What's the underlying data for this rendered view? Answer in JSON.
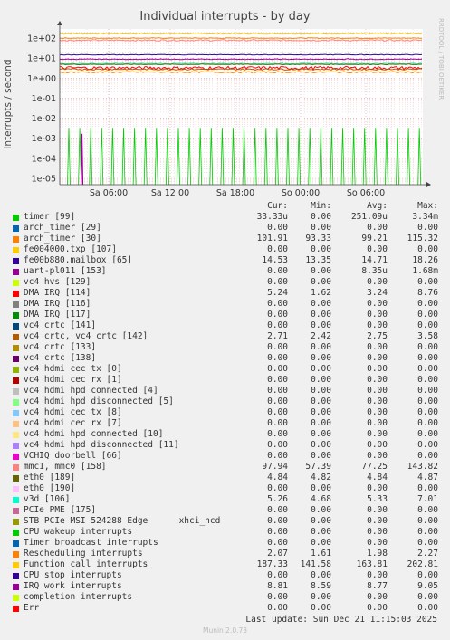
{
  "title": "Individual interrupts - by day",
  "side_text": "RRDTOOL / TOBI OETIKER",
  "footer": {
    "last_update": "Last update: Sun Dec 21 11:15:03 2025",
    "munin": "Munin 2.0.73"
  },
  "legend_headers": {
    "cur": "Cur:",
    "min": "Min:",
    "avg": "Avg:",
    "max": "Max:"
  },
  "legend": [
    {
      "label": "timer [99]",
      "color": "#00cc00",
      "cur": "33.33u",
      "min": "0.00",
      "avg": "251.09u",
      "max": "3.34m"
    },
    {
      "label": "arch_timer [29]",
      "color": "#0066b3",
      "cur": "0.00",
      "min": "0.00",
      "avg": "0.00",
      "max": "0.00"
    },
    {
      "label": "arch_timer [30]",
      "color": "#ff8000",
      "cur": "101.91",
      "min": "93.33",
      "avg": "99.21",
      "max": "115.32"
    },
    {
      "label": "fe004000.txp [107]",
      "color": "#ffcc00",
      "cur": "0.00",
      "min": "0.00",
      "avg": "0.00",
      "max": "0.00"
    },
    {
      "label": "fe00b880.mailbox [65]",
      "color": "#330099",
      "cur": "14.53",
      "min": "13.35",
      "avg": "14.71",
      "max": "18.26"
    },
    {
      "label": "uart-pl011 [153]",
      "color": "#990099",
      "cur": "0.00",
      "min": "0.00",
      "avg": "8.35u",
      "max": "1.68m"
    },
    {
      "label": "vc4 hvs [129]",
      "color": "#ccff00",
      "cur": "0.00",
      "min": "0.00",
      "avg": "0.00",
      "max": "0.00"
    },
    {
      "label": "DMA IRQ [114]",
      "color": "#ff0000",
      "cur": "5.24",
      "min": "1.62",
      "avg": "3.24",
      "max": "8.76"
    },
    {
      "label": "DMA IRQ [116]",
      "color": "#808080",
      "cur": "0.00",
      "min": "0.00",
      "avg": "0.00",
      "max": "0.00"
    },
    {
      "label": "DMA IRQ [117]",
      "color": "#008f00",
      "cur": "0.00",
      "min": "0.00",
      "avg": "0.00",
      "max": "0.00"
    },
    {
      "label": "vc4 crtc [141]",
      "color": "#00487d",
      "cur": "0.00",
      "min": "0.00",
      "avg": "0.00",
      "max": "0.00"
    },
    {
      "label": "vc4 crtc, vc4 crtc [142]",
      "color": "#b35a00",
      "cur": "2.71",
      "min": "2.42",
      "avg": "2.75",
      "max": "3.58"
    },
    {
      "label": "vc4 crtc [133]",
      "color": "#b38f00",
      "cur": "0.00",
      "min": "0.00",
      "avg": "0.00",
      "max": "0.00"
    },
    {
      "label": "vc4 crtc [138]",
      "color": "#6b006b",
      "cur": "0.00",
      "min": "0.00",
      "avg": "0.00",
      "max": "0.00"
    },
    {
      "label": "vc4 hdmi cec tx [0]",
      "color": "#8fb300",
      "cur": "0.00",
      "min": "0.00",
      "avg": "0.00",
      "max": "0.00"
    },
    {
      "label": "vc4 hdmi cec rx [1]",
      "color": "#b30000",
      "cur": "0.00",
      "min": "0.00",
      "avg": "0.00",
      "max": "0.00"
    },
    {
      "label": "vc4 hdmi hpd connected [4]",
      "color": "#bebebe",
      "cur": "0.00",
      "min": "0.00",
      "avg": "0.00",
      "max": "0.00"
    },
    {
      "label": "vc4 hdmi hpd disconnected [5]",
      "color": "#80ff80",
      "cur": "0.00",
      "min": "0.00",
      "avg": "0.00",
      "max": "0.00"
    },
    {
      "label": "vc4 hdmi cec tx [8]",
      "color": "#80c9ff",
      "cur": "0.00",
      "min": "0.00",
      "avg": "0.00",
      "max": "0.00"
    },
    {
      "label": "vc4 hdmi cec rx [7]",
      "color": "#ffc080",
      "cur": "0.00",
      "min": "0.00",
      "avg": "0.00",
      "max": "0.00"
    },
    {
      "label": "vc4 hdmi hpd connected [10]",
      "color": "#ffe680",
      "cur": "0.00",
      "min": "0.00",
      "avg": "0.00",
      "max": "0.00"
    },
    {
      "label": "vc4 hdmi hpd disconnected [11]",
      "color": "#aa80ff",
      "cur": "0.00",
      "min": "0.00",
      "avg": "0.00",
      "max": "0.00"
    },
    {
      "label": "VCHIQ doorbell [66]",
      "color": "#ee00cc",
      "cur": "0.00",
      "min": "0.00",
      "avg": "0.00",
      "max": "0.00"
    },
    {
      "label": "mmc1, mmc0 [158]",
      "color": "#ff8080",
      "cur": "97.94",
      "min": "57.39",
      "avg": "77.25",
      "max": "143.82"
    },
    {
      "label": "eth0 [189]",
      "color": "#666600",
      "cur": "4.84",
      "min": "4.82",
      "avg": "4.84",
      "max": "4.87"
    },
    {
      "label": "eth0 [190]",
      "color": "#ffbfff",
      "cur": "0.00",
      "min": "0.00",
      "avg": "0.00",
      "max": "0.00"
    },
    {
      "label": "v3d [106]",
      "color": "#00ffcc",
      "cur": "5.26",
      "min": "4.68",
      "avg": "5.33",
      "max": "7.01"
    },
    {
      "label": "PCIe PME [175]",
      "color": "#cc6699",
      "cur": "0.00",
      "min": "0.00",
      "avg": "0.00",
      "max": "0.00"
    },
    {
      "label": "STB PCIe MSI 524288 Edge      xhci_hcd",
      "color": "#999900",
      "cur": "0.00",
      "min": "0.00",
      "avg": "0.00",
      "max": "0.00"
    },
    {
      "label": "CPU wakeup interrupts",
      "color": "#00cc00",
      "cur": "0.00",
      "min": "0.00",
      "avg": "0.00",
      "max": "0.00"
    },
    {
      "label": "Timer broadcast interrupts",
      "color": "#0066b3",
      "cur": "0.00",
      "min": "0.00",
      "avg": "0.00",
      "max": "0.00"
    },
    {
      "label": "Rescheduling interrupts",
      "color": "#ff8000",
      "cur": "2.07",
      "min": "1.61",
      "avg": "1.98",
      "max": "2.27"
    },
    {
      "label": "Function call interrupts",
      "color": "#ffcc00",
      "cur": "187.33",
      "min": "141.58",
      "avg": "163.81",
      "max": "202.81"
    },
    {
      "label": "CPU stop interrupts",
      "color": "#330099",
      "cur": "0.00",
      "min": "0.00",
      "avg": "0.00",
      "max": "0.00"
    },
    {
      "label": "IRQ work interrupts",
      "color": "#990099",
      "cur": "8.81",
      "min": "8.59",
      "min2": "",
      "avg": "8.77",
      "max": "9.05"
    },
    {
      "label": "completion interrupts",
      "color": "#ccff00",
      "cur": "0.00",
      "min": "0.00",
      "avg": "0.00",
      "max": "0.00"
    },
    {
      "label": "Err",
      "color": "#ff0000",
      "cur": "0.00",
      "min": "0.00",
      "avg": "0.00",
      "max": "0.00"
    }
  ],
  "chart_data": {
    "type": "line",
    "title": "Individual interrupts - by day",
    "ylabel": "interrupts / second",
    "yscale": "log",
    "ylim": [
      5e-06,
      300
    ],
    "y_ticks": [
      "1e-05",
      "1e-04",
      "1e-03",
      "1e-02",
      "1e-01",
      "1e+00",
      "1e+01",
      "1e+02"
    ],
    "x_ticks": [
      "Sa 06:00",
      "Sa 12:00",
      "Sa 18:00",
      "So 00:00",
      "So 06:00"
    ],
    "grid": true,
    "series": [
      {
        "name": "Function call interrupts",
        "color": "#ffcc00",
        "avg": 163.81
      },
      {
        "name": "arch_timer [30]",
        "color": "#ff8000",
        "avg": 99.21
      },
      {
        "name": "mmc1, mmc0 [158]",
        "color": "#ff8080",
        "avg": 77.25
      },
      {
        "name": "fe00b880.mailbox [65]",
        "color": "#330099",
        "avg": 14.71
      },
      {
        "name": "IRQ work interrupts",
        "color": "#990099",
        "avg": 8.77
      },
      {
        "name": "v3d [106]",
        "color": "#00ffcc",
        "avg": 5.33
      },
      {
        "name": "eth0 [189]",
        "color": "#666600",
        "avg": 4.84
      },
      {
        "name": "DMA IRQ [114]",
        "color": "#ff0000",
        "avg": 3.24
      },
      {
        "name": "vc4 crtc, vc4 crtc [142]",
        "color": "#b35a00",
        "avg": 2.75
      },
      {
        "name": "Rescheduling interrupts",
        "color": "#ff8000",
        "avg": 1.98
      },
      {
        "name": "timer [99]",
        "color": "#00cc00",
        "spike": 0.00334
      },
      {
        "name": "uart-pl011 [153]",
        "color": "#990099",
        "spike": 0.00168
      }
    ]
  }
}
